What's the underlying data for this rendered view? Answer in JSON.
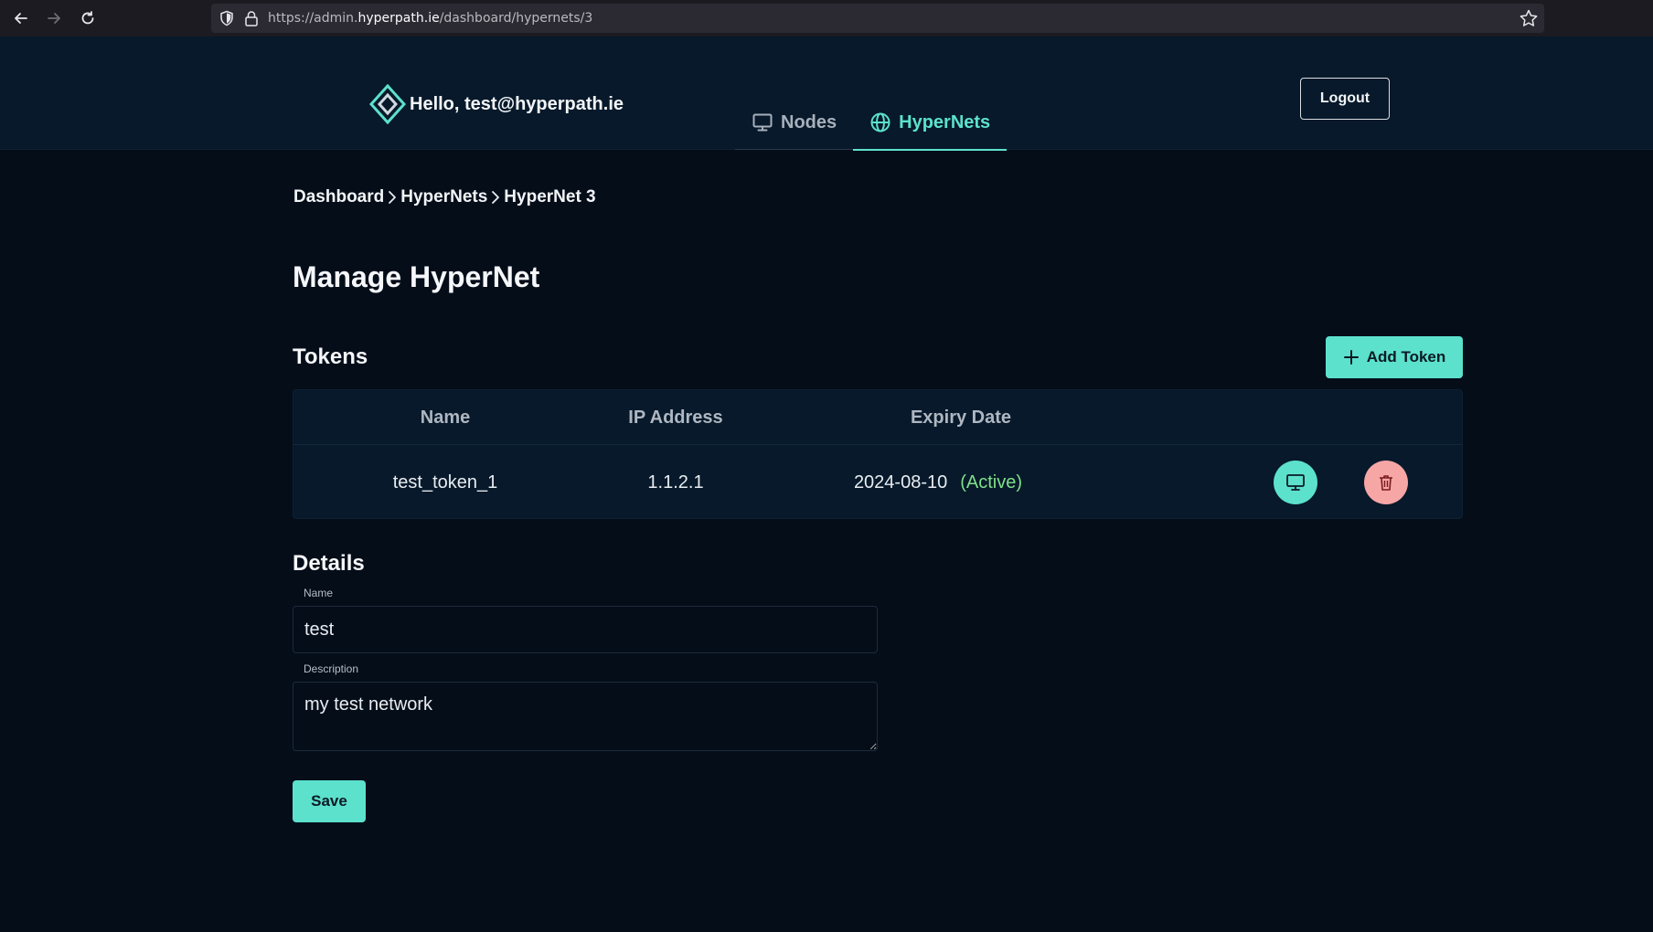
{
  "browser": {
    "url_prefix": "https://admin.",
    "url_host": "hyperpath.ie",
    "url_path": "/dashboard/hypernets/3"
  },
  "header": {
    "greeting": "Hello, test@hyperpath.ie",
    "logout_label": "Logout",
    "tabs": [
      {
        "label": "Nodes",
        "icon": "monitor-icon",
        "active": false
      },
      {
        "label": "HyperNets",
        "icon": "globe-icon",
        "active": true
      }
    ]
  },
  "breadcrumb": [
    "Dashboard",
    "HyperNets",
    "HyperNet 3"
  ],
  "page_title": "Manage HyperNet",
  "tokens": {
    "title": "Tokens",
    "add_label": "Add Token",
    "columns": [
      "Name",
      "IP Address",
      "Expiry Date"
    ],
    "rows": [
      {
        "name": "test_token_1",
        "ip": "1.1.2.1",
        "expiry": "2024-08-10",
        "status": "(Active)"
      }
    ]
  },
  "details": {
    "title": "Details",
    "name_label": "Name",
    "name_value": "test",
    "description_label": "Description",
    "description_value": "my test network",
    "save_label": "Save"
  },
  "colors": {
    "accent": "#5ce1cd",
    "danger": "#f7a6a6",
    "status_active": "#7fe08a",
    "background": "#050d19",
    "header_bg": "#07192a"
  }
}
